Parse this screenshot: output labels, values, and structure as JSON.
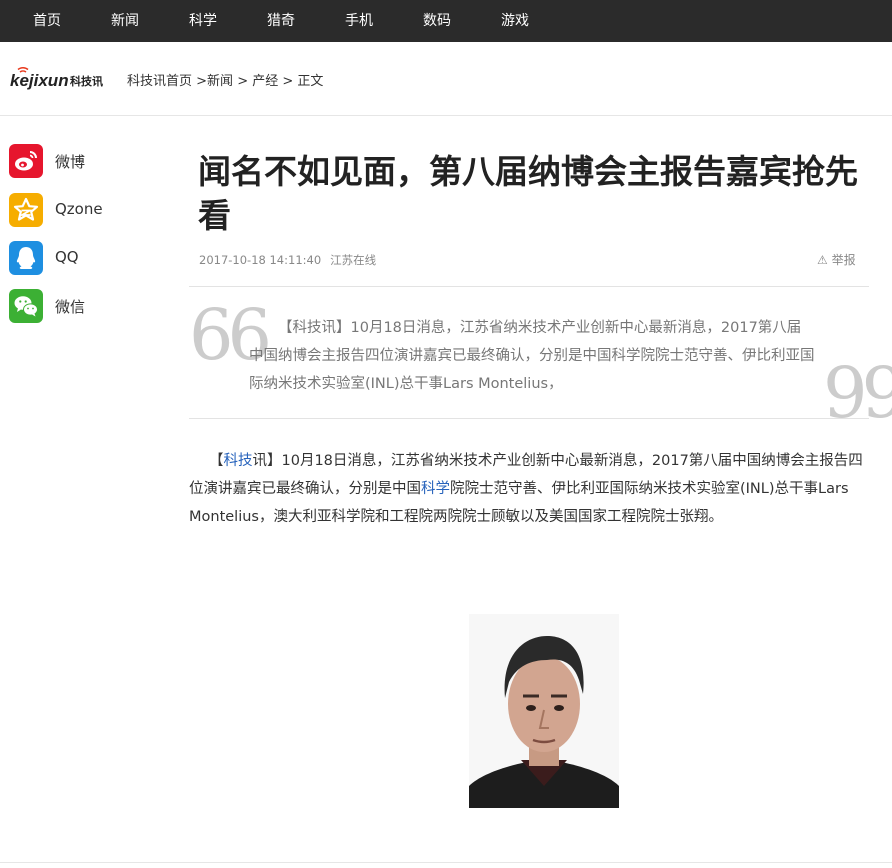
{
  "nav": {
    "items": [
      "首页",
      "新闻",
      "科学",
      "猎奇",
      "手机",
      "数码",
      "游戏"
    ]
  },
  "logo": {
    "text_en": "kejixun",
    "text_cn": "科技讯"
  },
  "breadcrumb": {
    "home": "科技讯首页",
    "sep1": " >",
    "news": "新闻",
    "sep2": " > ",
    "category": "产经",
    "sep3": " > ",
    "current": "正文"
  },
  "share": {
    "items": [
      {
        "label": "微博",
        "icon": "weibo-icon",
        "color": "#e6162d"
      },
      {
        "label": "Qzone",
        "icon": "qzone-icon",
        "color": "#f6ad00"
      },
      {
        "label": "QQ",
        "icon": "qq-icon",
        "color": "#1e8fe1"
      },
      {
        "label": "微信",
        "icon": "wechat-icon",
        "color": "#3cb034"
      }
    ]
  },
  "article": {
    "title": "闻名不如见面，第八届纳博会主报告嘉宾抢先看",
    "date": "2017-10-18 14:11:40",
    "source": "江苏在线",
    "report_label": "举报",
    "summary": "【科技讯】10月18日消息，江苏省纳米技术产业创新中心最新消息，2017第八届中国纳博会主报告四位演讲嘉宾已最终确认，分别是中国科学院院士范守善、伊比利亚国际纳米技术实验室(INL)总干事Lars Montelius，",
    "body": {
      "p1": "【",
      "p1_link": "科技",
      "p2": "讯】10月18日消息，江苏省纳米技术产业创新中心最新消息，2017第八届中国纳博会主报告四位演讲嘉宾已最终确认，分别是中国",
      "p2_link": "科学",
      "p3": "院院士范守善、伊比利亚国际纳米技术实验室(INL)总干事Lars Montelius，澳大利亚科学院和工程院两院院士顾敏以及美国国家工程院院士张翔。"
    }
  },
  "colors": {
    "nav_bg": "#2b2b2b",
    "link": "#2763bc"
  }
}
